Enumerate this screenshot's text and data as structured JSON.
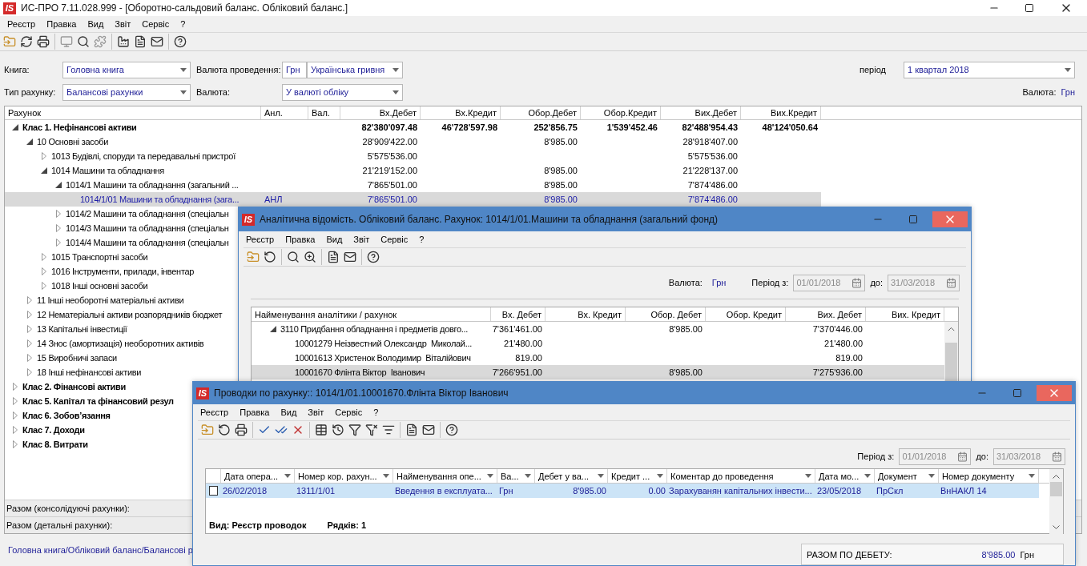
{
  "main_window": {
    "logo": "IS",
    "title": "ИС-ПРО 7.11.028.999 - [Оборотно-сальдовий баланс. Обліковий баланс.]",
    "menu": [
      "Реєстр",
      "Правка",
      "Вид",
      "Звіт",
      "Сервіс",
      "?"
    ],
    "filters": {
      "book": {
        "label": "Книга:",
        "value": "Головна книга"
      },
      "posting_currency": {
        "label": "Валюта проведення:",
        "code": "Грн",
        "value": "Українська гривня"
      },
      "period": {
        "label": "період",
        "value": "1 квартал 2018"
      },
      "account_type": {
        "label": "Тип рахунку:",
        "value": "Балансові рахунки"
      },
      "currency": {
        "label": "Валюта:",
        "value": "У валюті обліку"
      },
      "currency_display": {
        "label": "Валюта:",
        "value": "Грн"
      }
    },
    "table": {
      "columns": [
        "Рахунок",
        "Анл.",
        "Вал.",
        "Вх.Дебет",
        "Вх.Кредит",
        "Обор.Дебет",
        "Обор.Кредит",
        "Вих.Дебет",
        "Вих.Кредит"
      ],
      "rows": [
        {
          "name": "Клас 1. Нефінансові активи",
          "expanded": true,
          "selected": false,
          "values": {
            "in_debit": "82'380'097.48",
            "in_credit": "46'728'597.98",
            "turnover_debit": "252'856.75",
            "turnover_credit": "1'539'452.46",
            "out_debit": "82'488'954.43",
            "out_credit": "48'124'050.64"
          },
          "children": [
            {
              "name": "10 Основні засоби",
              "expanded": true,
              "selected": false,
              "values": {
                "in_debit": "28'909'422.00",
                "turnover_debit": "8'985.00",
                "out_debit": "28'918'407.00"
              },
              "children": [
                {
                  "name": "1013 Будівлі, споруди та передавальні пристрої",
                  "expanded": false,
                  "selected": false,
                  "values": {
                    "in_debit": "5'575'536.00",
                    "out_debit": "5'575'536.00"
                  }
                },
                {
                  "name": "1014 Машини та обладнання",
                  "expanded": true,
                  "selected": false,
                  "values": {
                    "in_debit": "21'219'152.00",
                    "turnover_debit": "8'985.00",
                    "out_debit": "21'228'137.00"
                  },
                  "children": [
                    {
                      "name": "1014/1 Машини та обладнання (загальний ...",
                      "expanded": true,
                      "selected": false,
                      "values": {
                        "in_debit": "7'865'501.00",
                        "turnover_debit": "8'985.00",
                        "out_debit": "7'874'486.00"
                      },
                      "children": [
                        {
                          "name": "1014/1/01 Машини та обладнання (зага...",
                          "anl": "АНЛ",
                          "selected": true,
                          "values": {
                            "in_debit": "7'865'501.00",
                            "turnover_debit": "8'985.00",
                            "out_debit": "7'874'486.00"
                          }
                        }
                      ]
                    },
                    {
                      "name": "1014/2 Машини та обладнання (спеціальн",
                      "expanded": false,
                      "selected": false
                    },
                    {
                      "name": "1014/3 Машини та обладнання (спеціальн",
                      "expanded": false,
                      "selected": false
                    },
                    {
                      "name": "1014/4 Машини та обладнання (спеціальн",
                      "expanded": false,
                      "selected": false
                    }
                  ]
                },
                {
                  "name": "1015 Транспортні засоби",
                  "expanded": false,
                  "selected": false
                },
                {
                  "name": "1016 Інструменти, прилади, інвентар",
                  "expanded": false,
                  "selected": false
                },
                {
                  "name": "1018 Інші основні засоби",
                  "expanded": false,
                  "selected": false
                }
              ]
            },
            {
              "name": "11 Інші необоротні матеріальні активи",
              "expanded": false,
              "selected": false
            },
            {
              "name": "12 Нематеріальні активи розпорядників бюджет",
              "expanded": false,
              "selected": false
            },
            {
              "name": "13 Капітальні інвестиції",
              "expanded": false,
              "selected": false
            },
            {
              "name": "14 Знос (амортизація) необоротних активів",
              "expanded": false,
              "selected": false
            },
            {
              "name": "15 Виробничі запаси",
              "expanded": false,
              "selected": false
            },
            {
              "name": "18 Інші нефінансові активи",
              "expanded": false,
              "selected": false
            }
          ]
        },
        {
          "name": "Клас 2. Фінансові активи",
          "expanded": false,
          "selected": false
        },
        {
          "name": "Клас 5. Капітал та фінансовий резул",
          "expanded": false,
          "selected": false
        },
        {
          "name": "Клас 6. Зобов’язання",
          "expanded": false,
          "selected": false
        },
        {
          "name": "Клас 7. Доходи",
          "expanded": false,
          "selected": false
        },
        {
          "name": "Клас 8. Витрати",
          "expanded": false,
          "selected": false
        }
      ]
    },
    "totals": [
      "Разом (консолідуючі рахунки):",
      "Разом (детальні рахунки):"
    ],
    "status_bar": "Головна книга/Обліковий баланс/Балансові р"
  },
  "analytics_window": {
    "logo": "IS",
    "title": "Аналітична відомість. Обліковий баланс. Рахунок: 1014/1/01.Машини та обладнання (загальний фонд)",
    "menu": [
      "Реєстр",
      "Правка",
      "Вид",
      "Звіт",
      "Сервіс",
      "?"
    ],
    "currency": {
      "label": "Валюта:",
      "value": "Грн"
    },
    "period": {
      "label": "Період з:",
      "from": "01/01/2018",
      "to_label": "до:",
      "to": "31/03/2018",
      "disabled": true
    },
    "table": {
      "columns": [
        "Найменування аналітики / рахунок",
        "Вх. Дебет",
        "Вх. Кредит",
        "Обор. Дебет",
        "Обор. Кредит",
        "Вих. Дебет",
        "Вих. Кредит"
      ],
      "rows": [
        {
          "name": "3110 Придбання обладнання і предметів довго...",
          "expanded": true,
          "selected": false,
          "values": {
            "in_debit": "7'361'461.00",
            "turnover_debit": "8'985.00",
            "out_debit": "7'370'446.00"
          },
          "children": [
            {
              "name": "10001279 Неізвестний Олександр  Миколай...",
              "selected": false,
              "values": {
                "in_debit": "21'480.00",
                "out_debit": "21'480.00"
              }
            },
            {
              "name": "10001613 Христенок Володимир  Віталійович",
              "selected": false,
              "values": {
                "in_debit": "819.00",
                "out_debit": "819.00"
              }
            },
            {
              "name": "10001670 Флінта Віктор  Іванович",
              "selected": true,
              "values": {
                "in_debit": "7'266'951.00",
                "turnover_debit": "8'985.00",
                "out_debit": "7'275'936.00"
              }
            }
          ]
        }
      ]
    }
  },
  "entries_window": {
    "logo": "IS",
    "title": "Проводки по рахунку:: 1014/1/01.10001670.Флінта Віктор  Іванович",
    "menu": [
      "Реєстр",
      "Правка",
      "Вид",
      "Звіт",
      "Сервіс",
      "?"
    ],
    "period": {
      "label": "Період з:",
      "from": "01/01/2018",
      "to_label": "до:",
      "to": "31/03/2018",
      "disabled": true
    },
    "table": {
      "columns": [
        "Дата опера...",
        "Номер кор. рахун...",
        "Найменування опе...",
        "Ва...",
        "Дебет у ва...",
        "Кредит ...",
        "Коментар до проведення",
        "Дата мо...",
        "Документ",
        "Номер документу"
      ],
      "rows": [
        {
          "checked": false,
          "selected": true,
          "cells": [
            "26/02/2018",
            "1311/1/01",
            "Введення в експлуата...",
            "Грн",
            "8'985.00",
            "0.00",
            "Зарахуванян капітальних інвести...",
            "23/05/2018",
            "ПрСкл",
            "ВнНАКЛ 14"
          ]
        }
      ]
    },
    "footer": {
      "view": "Вид: Реєстр проводок",
      "rows": "Рядків: 1"
    },
    "total": {
      "label": "РАЗОМ ПО ДЕБЕТУ:",
      "value": "8'985.00",
      "currency": "Грн"
    }
  }
}
